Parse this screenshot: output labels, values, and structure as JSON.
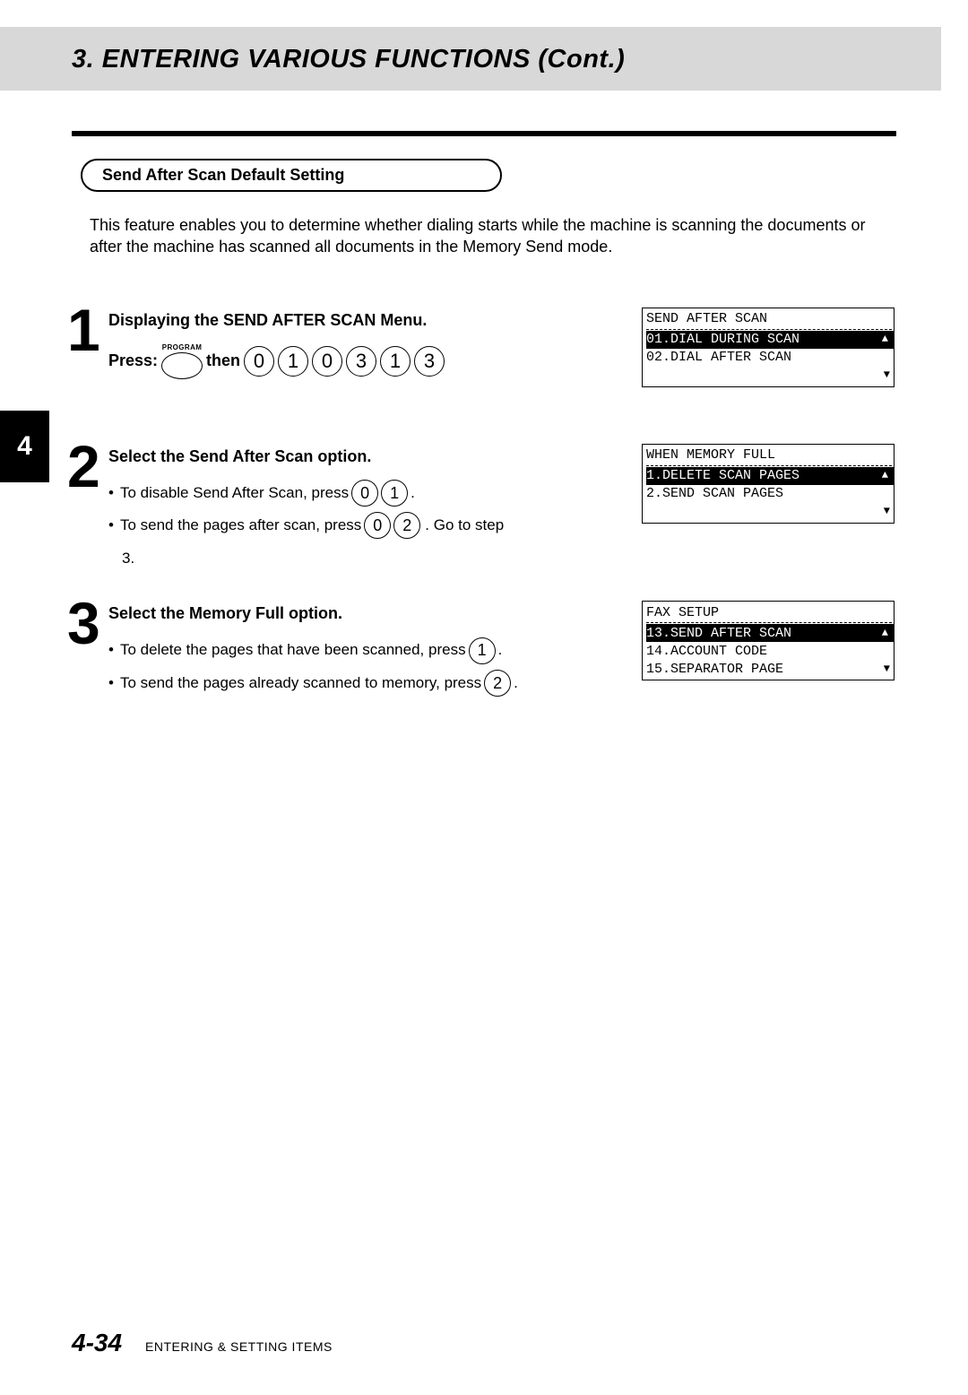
{
  "header_title": "3. ENTERING VARIOUS FUNCTIONS (Cont.)",
  "pill_label": "Send After Scan Default Setting",
  "intro_text": "This feature enables you to determine whether dialing starts while the machine is scanning the documents or after the machine has scanned all documents in the Memory Send mode.",
  "side_tab": "4",
  "steps": {
    "s1": {
      "num": "1",
      "title": "Displaying the SEND AFTER SCAN Menu.",
      "press_word": "Press:",
      "program_label": "PROGRAM",
      "then_word": "then",
      "keys": [
        "0",
        "1",
        "0",
        "3",
        "1",
        "3"
      ]
    },
    "s2": {
      "num": "2",
      "title": "Select the Send After Scan option.",
      "b1_pre": "To disable Send After Scan, press",
      "b1_keys": [
        "0",
        "1"
      ],
      "b2_pre": "To send the pages after scan, press",
      "b2_keys": [
        "0",
        "2"
      ],
      "b2_post": ". Go to step",
      "b2_line2": "3."
    },
    "s3": {
      "num": "3",
      "title": "Select the Memory Full option.",
      "b1_pre": "To delete the pages that have been scanned, press",
      "b1_key": "1",
      "b2_pre": "To send the pages already scanned to memory, press",
      "b2_key": "2"
    }
  },
  "lcd1": {
    "l1": "SEND AFTER SCAN",
    "l2": "01.DIAL DURING SCAN",
    "l3": "02.DIAL AFTER SCAN"
  },
  "lcd2": {
    "l1": "WHEN MEMORY FULL",
    "l2": "1.DELETE SCAN PAGES",
    "l3": "2.SEND SCAN PAGES"
  },
  "lcd3": {
    "l1": "FAX SETUP",
    "l2": "13.SEND AFTER SCAN",
    "l3": "14.ACCOUNT CODE",
    "l4": "15.SEPARATOR PAGE"
  },
  "footer": {
    "page": "4-34",
    "section": "ENTERING & SETTING ITEMS"
  }
}
